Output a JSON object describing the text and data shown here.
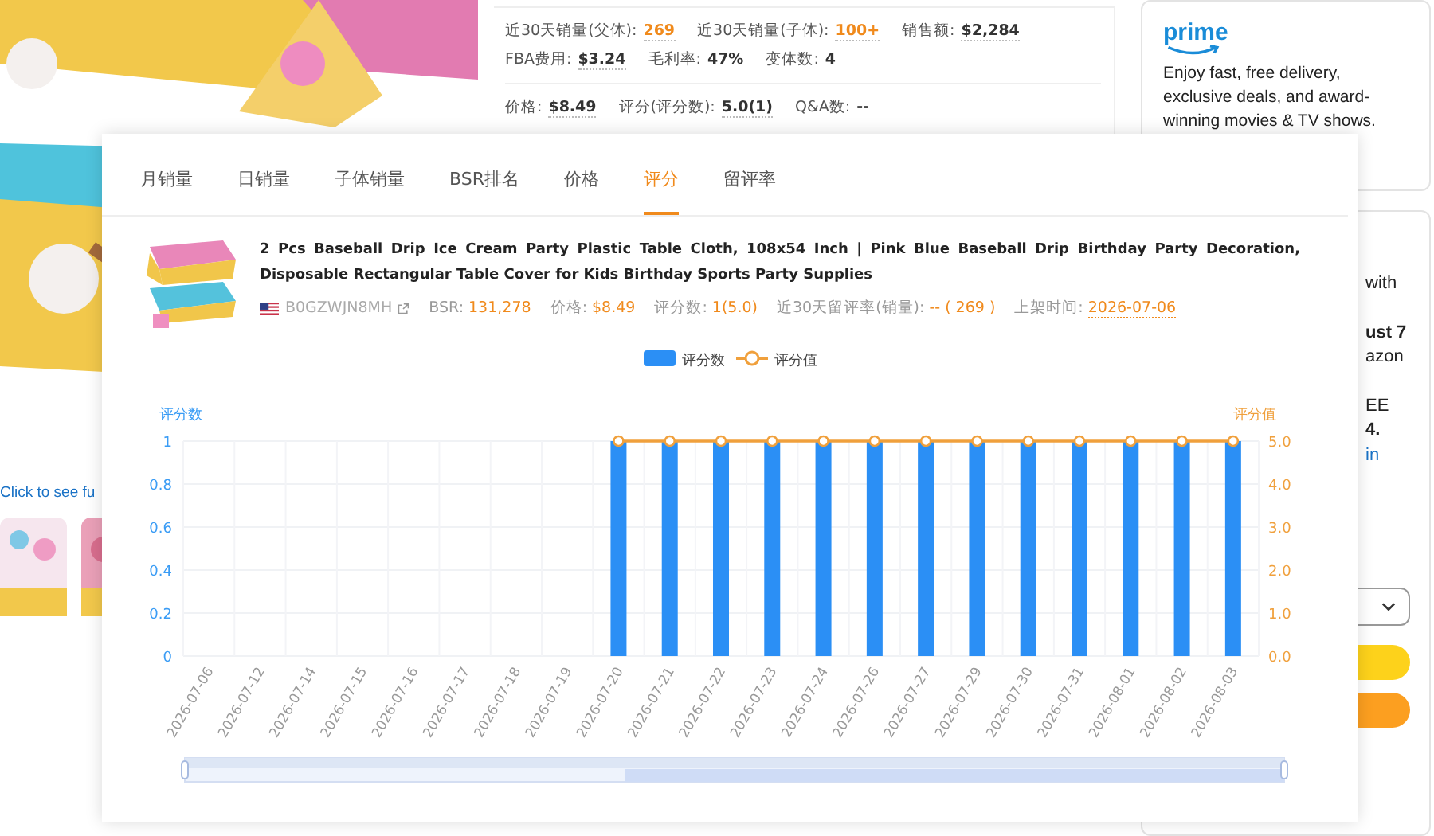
{
  "gallery": {
    "link": "Click to see fu"
  },
  "stats_groups": [
    {
      "rows": [
        {
          "items": [
            {
              "label": "近30天销量(父体):",
              "value": "269",
              "highlight": true,
              "underlined": true
            },
            {
              "label": "近30天销量(子体):",
              "value": "100+",
              "highlight": true,
              "underlined": true
            },
            {
              "label": "销售额:",
              "value": "$2,284",
              "highlight": false,
              "underlined": true
            }
          ]
        },
        {
          "items": [
            {
              "label": "FBA费用:",
              "value": "$3.24",
              "highlight": false,
              "underlined": true
            },
            {
              "label": "毛利率:",
              "value": "47%",
              "highlight": false,
              "underlined": false
            },
            {
              "label": "变体数:",
              "value": "4",
              "highlight": false,
              "underlined": false
            }
          ]
        }
      ]
    },
    {
      "rows": [
        {
          "items": [
            {
              "label": "价格:",
              "value": "$8.49",
              "highlight": false,
              "underlined": true
            },
            {
              "label": "评分(评分数):",
              "value": "5.0(1)",
              "highlight": false,
              "underlined": true
            },
            {
              "label": "Q&A数:",
              "value": "--",
              "highlight": false,
              "underlined": false
            }
          ]
        }
      ]
    }
  ],
  "prime_card": {
    "logo": "prime",
    "text": "Enjoy fast, free delivery, exclusive deals, and award-winning movies & TV shows."
  },
  "buy_box": {
    "blocks": [
      {
        "lines": [
          {
            "text": "with",
            "kind": "plain"
          }
        ]
      },
      {
        "lines": [
          {
            "text": "ust 7",
            "kind": "bold"
          },
          {
            "text": "azon",
            "kind": "plain"
          }
        ]
      },
      {
        "lines": [
          {
            "text": "EE",
            "kind": "plain"
          },
          {
            "text": "4.",
            "kind": "bold"
          },
          {
            "text": "in",
            "kind": "link"
          }
        ]
      }
    ]
  },
  "popup": {
    "tabs": [
      {
        "label": "月销量",
        "selected": false
      },
      {
        "label": "日销量",
        "selected": false
      },
      {
        "label": "子体销量",
        "selected": false
      },
      {
        "label": "BSR排名",
        "selected": false
      },
      {
        "label": "价格",
        "selected": false
      },
      {
        "label": "评分",
        "selected": true
      },
      {
        "label": "留评率",
        "selected": false
      }
    ],
    "product": {
      "title": "2 Pcs Baseball Drip Ice Cream Party Plastic Table Cloth, 108x54 Inch | Pink Blue Baseball Drip Birthday Party Decoration, Disposable Rectangular Table Cover for Kids Birthday Sports Party Supplies",
      "asin": "B0GZWJN8MH",
      "meta": [
        {
          "label": "BSR:",
          "value": "131,278",
          "kind": "plain"
        },
        {
          "label": "价格:",
          "value": "$8.49",
          "kind": "plain"
        },
        {
          "label": "评分数:",
          "value": "1(5.0)",
          "kind": "plain"
        },
        {
          "label": "近30天留评率(销量):",
          "value": "-- ( 269 )",
          "kind": "plain"
        },
        {
          "label": "上架时间:",
          "value": "2026-07-06",
          "kind": "date"
        }
      ]
    },
    "chart": {
      "chart_data": {
        "type": "bar",
        "categories": [
          "2026-07-06",
          "2026-07-12",
          "2026-07-14",
          "2026-07-15",
          "2026-07-16",
          "2026-07-17",
          "2026-07-18",
          "2026-07-19",
          "2026-07-20",
          "2026-07-21",
          "2026-07-22",
          "2026-07-23",
          "2026-07-24",
          "2026-07-26",
          "2026-07-27",
          "2026-07-29",
          "2026-07-30",
          "2026-07-31",
          "2026-08-01",
          "2026-08-02",
          "2026-08-03"
        ],
        "series": [
          {
            "name": "评分数",
            "color": "#2b8ff5",
            "values": [
              0,
              0,
              0,
              0,
              0,
              0,
              0,
              0,
              1,
              1,
              1,
              1,
              1,
              1,
              1,
              1,
              1,
              1,
              1,
              1,
              1
            ]
          },
          {
            "name": "评分值",
            "color": "#f0a03c",
            "type": "line",
            "axis": "y2",
            "marker": "circle",
            "values": [
              null,
              null,
              null,
              null,
              null,
              null,
              null,
              null,
              5,
              5,
              5,
              5,
              5,
              5,
              5,
              5,
              5,
              5,
              5,
              5,
              5
            ]
          }
        ],
        "grid": true,
        "legend": true,
        "ylabel": "评分数",
        "ylim": [
          0,
          1
        ],
        "yticks": [
          0,
          0.2,
          0.4,
          0.6,
          0.8,
          1
        ],
        "y2label": "评分值",
        "y2lim": [
          0,
          5
        ],
        "y2ticks": [
          {
            "value": 0,
            "label": "0.0"
          },
          {
            "value": 1,
            "label": "1.0"
          },
          {
            "value": 2,
            "label": "2.0"
          },
          {
            "value": 3,
            "label": "3.0"
          },
          {
            "value": 4,
            "label": "4.0"
          },
          {
            "value": 5,
            "label": "5.0"
          }
        ]
      }
    }
  }
}
